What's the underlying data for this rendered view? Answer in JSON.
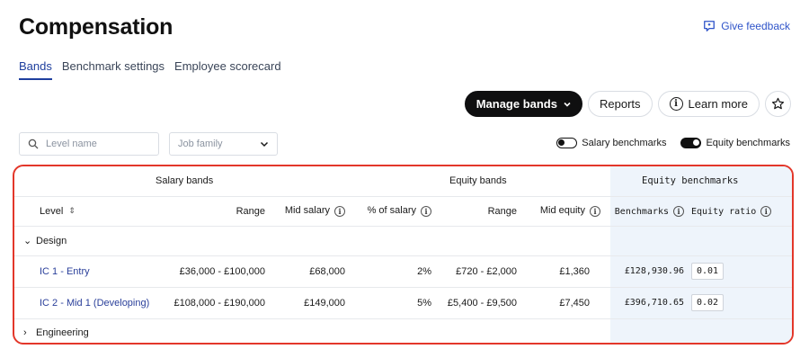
{
  "header": {
    "title": "Compensation",
    "feedback_label": "Give feedback"
  },
  "tabs": [
    {
      "label": "Bands",
      "active": true
    },
    {
      "label": "Benchmark settings",
      "active": false
    },
    {
      "label": "Employee scorecard",
      "active": false
    }
  ],
  "toolbar": {
    "manage_label": "Manage bands",
    "reports_label": "Reports",
    "learn_label": "Learn more"
  },
  "filters": {
    "search_placeholder": "Level name",
    "job_family_placeholder": "Job family"
  },
  "toggles": {
    "salary_label": "Salary benchmarks",
    "salary_on": false,
    "equity_label": "Equity benchmarks",
    "equity_on": true
  },
  "table": {
    "group_headers": {
      "salary": "Salary bands",
      "equity": "Equity bands",
      "benchmarks": "Equity benchmarks"
    },
    "columns": {
      "level": "Level",
      "range": "Range",
      "mid_salary": "Mid salary",
      "pct_salary": "% of salary",
      "eq_range": "Range",
      "mid_equity": "Mid equity",
      "benchmarks": "Benchmarks",
      "equity_ratio": "Equity ratio"
    },
    "groups": [
      {
        "name": "Design",
        "expanded": true
      },
      {
        "name": "Engineering",
        "expanded": false
      }
    ],
    "rows": [
      {
        "level": "IC 1 - Entry",
        "range": "£36,000 - £100,000",
        "mid_salary": "£68,000",
        "pct_salary": "2%",
        "eq_range": "£720 - £2,000",
        "mid_equity": "£1,360",
        "benchmark": "£128,930.96",
        "ratio": "0.01"
      },
      {
        "level": "IC 2 - Mid 1 (Developing)",
        "range": "£108,000 - £190,000",
        "mid_salary": "£149,000",
        "pct_salary": "5%",
        "eq_range": "£5,400 - £9,500",
        "mid_equity": "£7,450",
        "benchmark": "£396,710.65",
        "ratio": "0.02"
      }
    ]
  },
  "colors": {
    "accent_blue": "#2f54c9",
    "highlight_border": "#e3372a",
    "benchmark_bg": "#eef4fb"
  }
}
